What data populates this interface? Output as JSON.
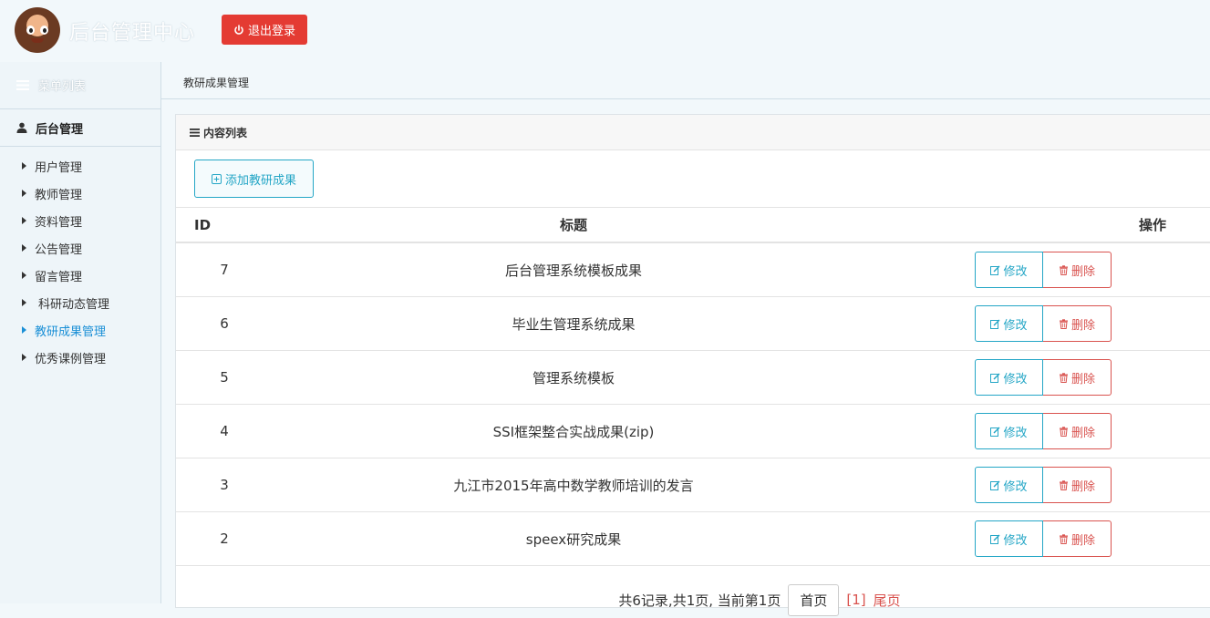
{
  "header": {
    "title": "后台管理中心",
    "logout_label": "退出登录"
  },
  "sidebar": {
    "menu_title": "菜单列表",
    "group_label": "后台管理",
    "items": [
      {
        "label": "用户管理"
      },
      {
        "label": "教师管理"
      },
      {
        "label": "资料管理"
      },
      {
        "label": "公告管理"
      },
      {
        "label": "留言管理"
      },
      {
        "label": "科研动态管理"
      },
      {
        "label": "教研成果管理",
        "active": true
      },
      {
        "label": "优秀课例管理"
      }
    ]
  },
  "breadcrumb": "教研成果管理",
  "panel": {
    "title": "内容列表",
    "add_label": "添加教研成果",
    "columns": {
      "id": "ID",
      "title": "标题",
      "ops": "操作"
    },
    "edit_label": "修改",
    "delete_label": "删除",
    "rows": [
      {
        "id": "7",
        "title": "后台管理系统模板成果"
      },
      {
        "id": "6",
        "title": "毕业生管理系统成果"
      },
      {
        "id": "5",
        "title": "管理系统模板"
      },
      {
        "id": "4",
        "title": "SSI框架整合实战成果(zip)"
      },
      {
        "id": "3",
        "title": "九江市2015年高中数学教师培训的发言"
      },
      {
        "id": "2",
        "title": "speex研究成果"
      }
    ]
  },
  "pagination": {
    "summary": "共6记录,共1页, 当前第1页",
    "first_label": "首页",
    "current_page": "[1]",
    "last_label": "尾页"
  },
  "colors": {
    "logout_bg": "#e43b33",
    "accent": "#24a6c6",
    "danger": "#d9534f",
    "active_nav": "#1a8fd6"
  }
}
